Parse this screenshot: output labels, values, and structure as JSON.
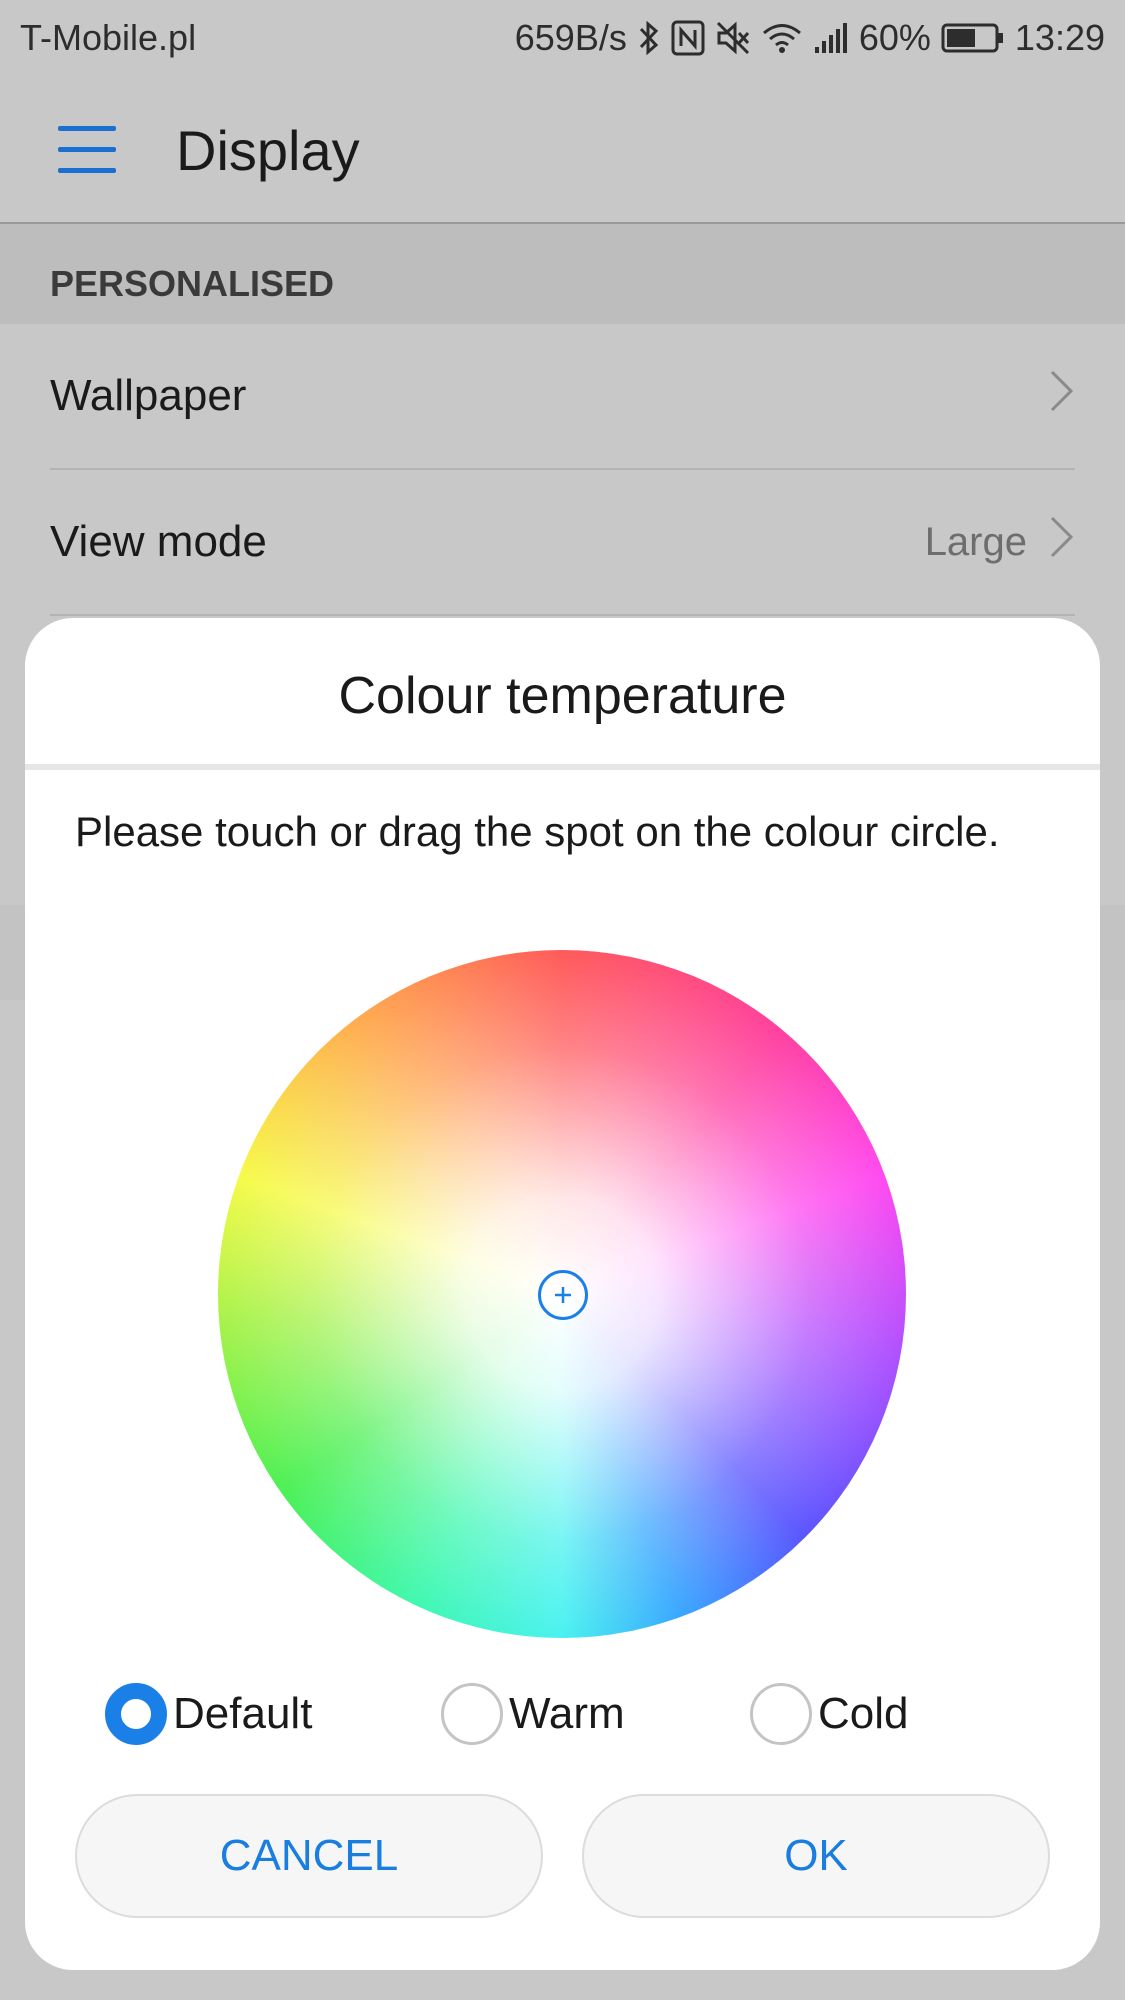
{
  "status_bar": {
    "carrier": "T-Mobile.pl",
    "net_speed": "659B/s",
    "battery_percent": "60%",
    "battery_level": 0.6,
    "time": "13:29"
  },
  "action_bar": {
    "title": "Display"
  },
  "settings": {
    "section_header": "PERSONALISED",
    "rows": [
      {
        "label": "Wallpaper",
        "value": ""
      },
      {
        "label": "View mode",
        "value": "Large"
      }
    ]
  },
  "dialog": {
    "title": "Colour temperature",
    "instructions": "Please touch or drag the spot on the colour circle.",
    "options": [
      {
        "label": "Default",
        "selected": true
      },
      {
        "label": "Warm",
        "selected": false
      },
      {
        "label": "Cold",
        "selected": false
      }
    ],
    "cancel_label": "CANCEL",
    "ok_label": "OK"
  },
  "colors": {
    "accent": "#1a80e8",
    "dim_background": "#c8c8c8"
  }
}
